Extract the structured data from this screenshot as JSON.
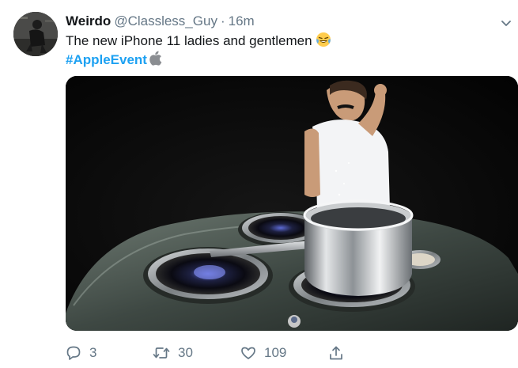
{
  "tweet": {
    "display_name": "Weirdo",
    "handle": "@Classless_Guy",
    "separator": "·",
    "time": "16m",
    "text": "The new iPhone 11 ladies and gentlemen",
    "emoji": "laughing-tears-emoji",
    "hashtag": "#AppleEvent",
    "hashtag_icon": "apple-logo-icon"
  },
  "actions": {
    "reply_count": "3",
    "retweet_count": "30",
    "like_count": "109"
  },
  "colors": {
    "link": "#1da1f2",
    "muted": "#657786",
    "text": "#14171a"
  }
}
